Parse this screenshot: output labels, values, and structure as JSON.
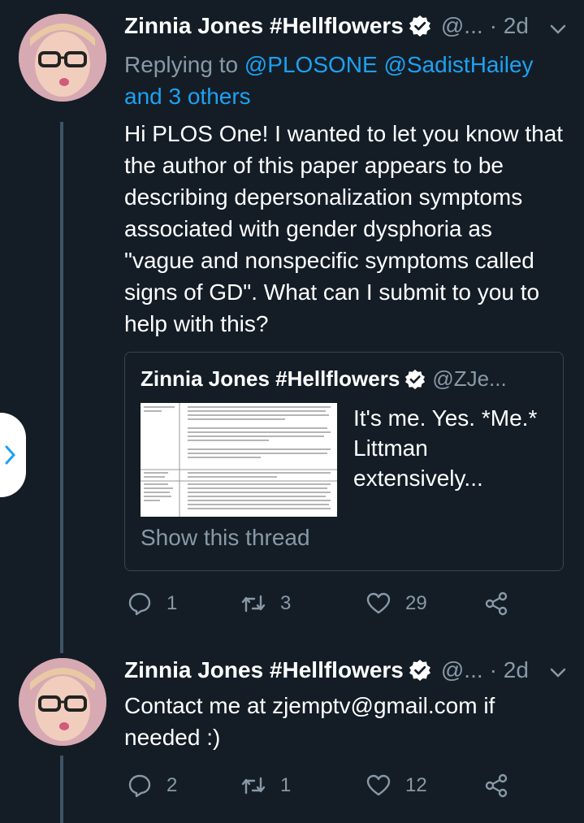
{
  "tweet1": {
    "display_name": "Zinnia Jones #Hellflowers",
    "handle": "@...",
    "time": "· 2d",
    "replying_prefix": "Replying to",
    "replying_to": [
      "@PLOSONE",
      "@SadistHailey"
    ],
    "and_others": "and 3 others",
    "text": "Hi PLOS One! I wanted to let you know that the author of this paper appears to be describing depersonalization symptoms associated with gender dysphoria as \"vague and nonspecific symptoms called signs of GD\". What can I submit to you to help with this?",
    "quote": {
      "display_name": "Zinnia Jones #Hellflowers",
      "handle": "@ZJe...",
      "text": "It's me. Yes. *Me.* Littman extensively...",
      "show_thread": "Show this thread"
    },
    "actions": {
      "replies": "1",
      "retweets": "3",
      "likes": "29"
    }
  },
  "tweet2": {
    "display_name": "Zinnia Jones #Hellflowers",
    "handle": "@...",
    "time": "· 2d",
    "text": "Contact me at zjemptv@gmail.com if needed :)",
    "actions": {
      "replies": "2",
      "retweets": "1",
      "likes": "12"
    }
  },
  "colors": {
    "background": "#141d26",
    "link": "#1da1f2",
    "muted": "#8899a6",
    "thread_line": "#3d5466"
  },
  "icons": [
    "verified-icon",
    "chevron-down-icon",
    "reply-icon",
    "retweet-icon",
    "like-icon",
    "share-icon",
    "chevron-right-icon"
  ]
}
